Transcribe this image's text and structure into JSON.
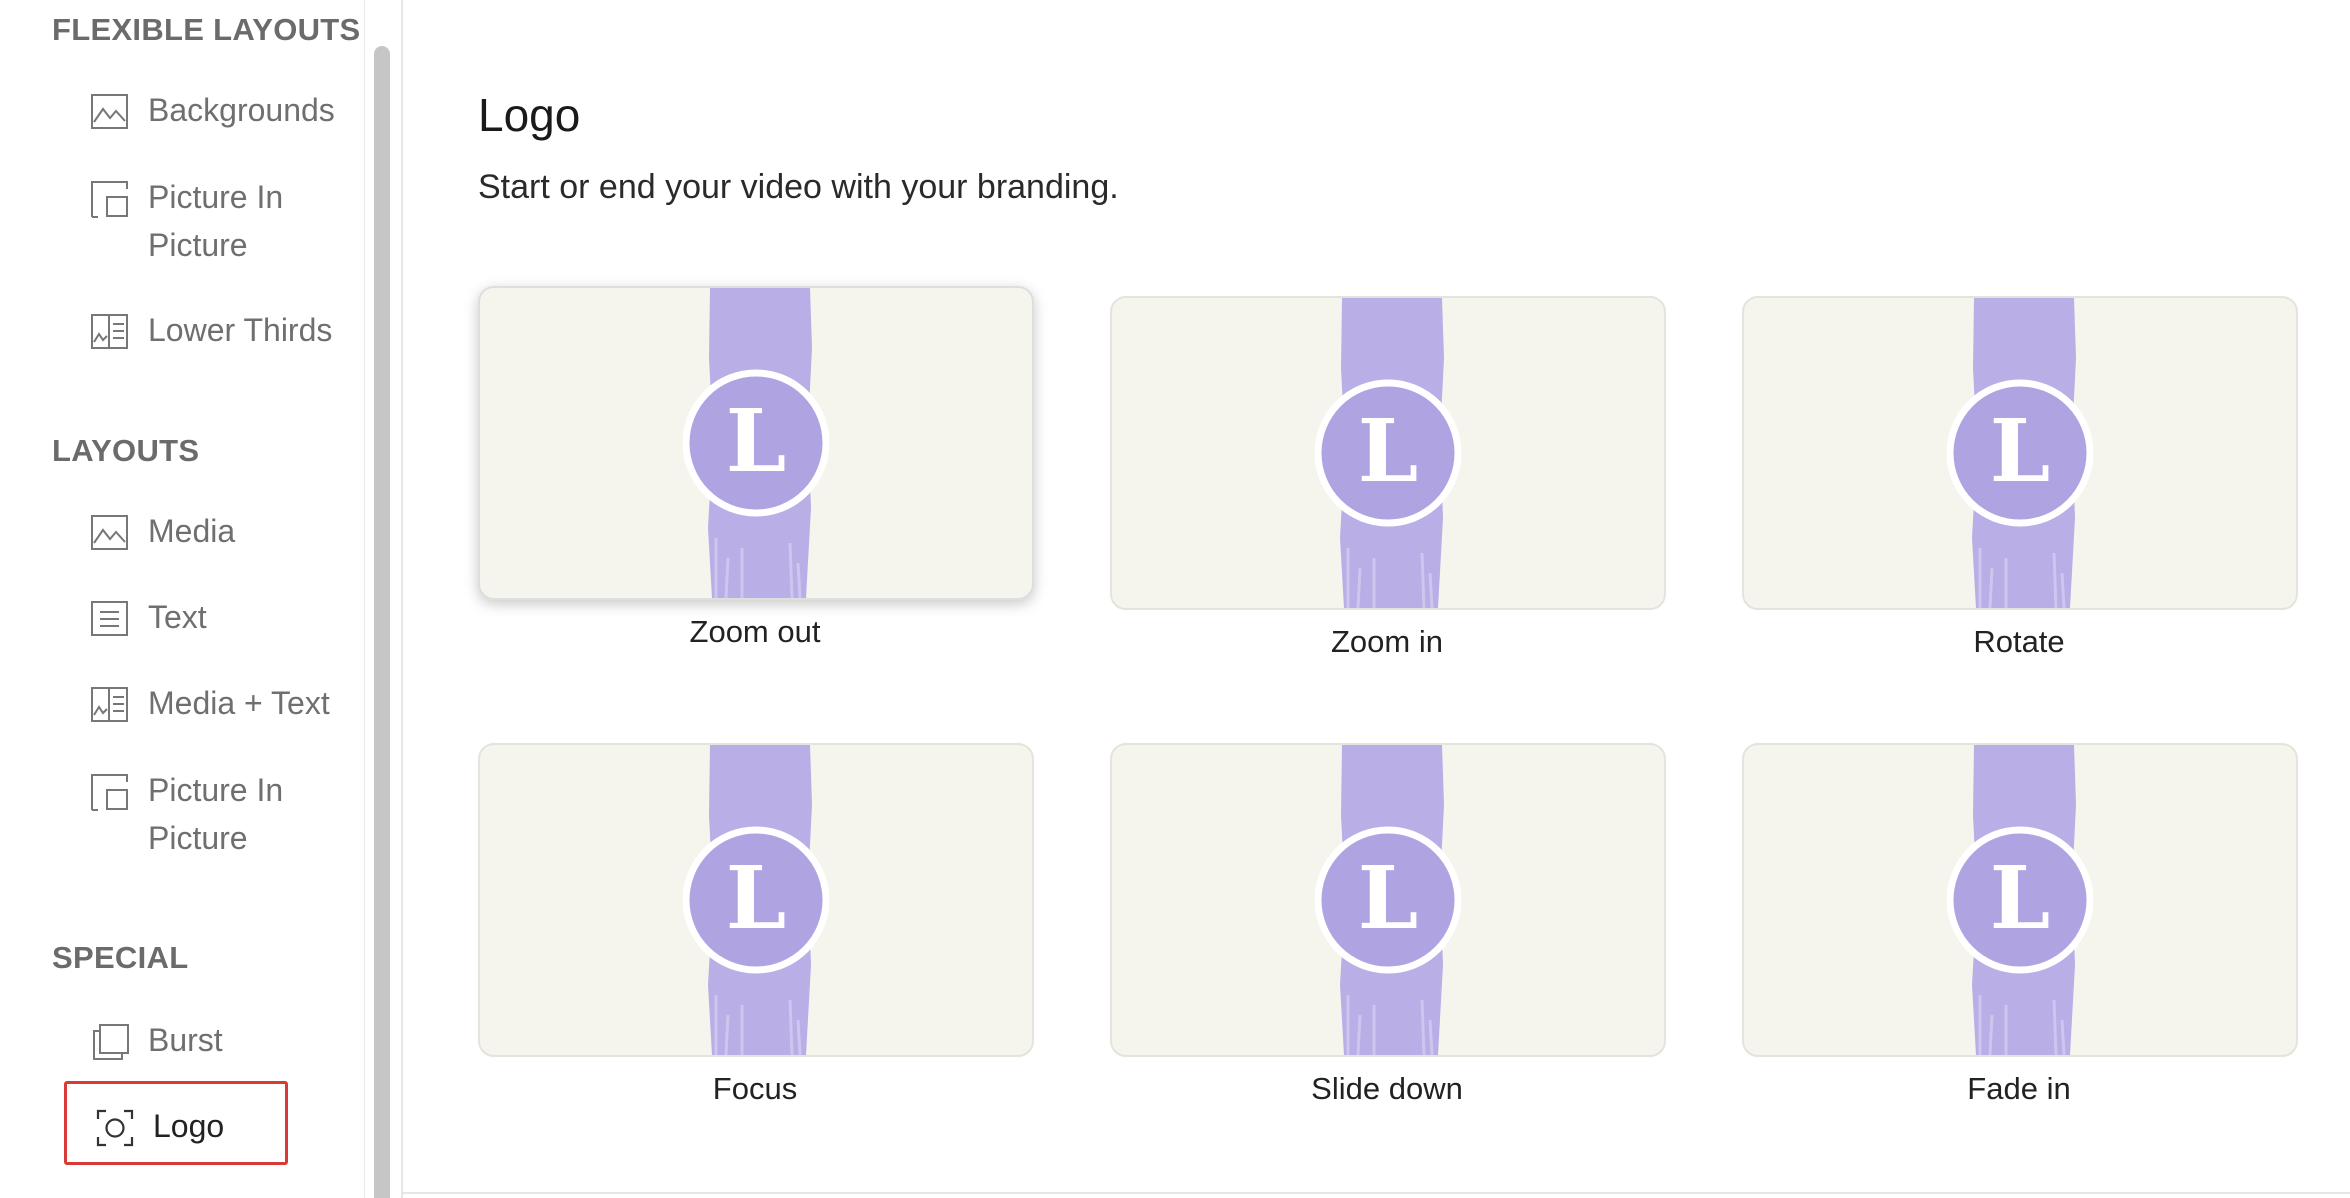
{
  "sidebar": {
    "sections": [
      {
        "title": "FLEXIBLE LAYOUTS",
        "items": [
          {
            "label": "Backgrounds",
            "icon": "image-icon"
          },
          {
            "label": "Picture In Picture",
            "icon": "picture-in-picture-icon"
          },
          {
            "label": "Lower Thirds",
            "icon": "lower-thirds-icon"
          }
        ]
      },
      {
        "title": "LAYOUTS",
        "items": [
          {
            "label": "Media",
            "icon": "image-icon"
          },
          {
            "label": "Text",
            "icon": "text-icon"
          },
          {
            "label": "Media + Text",
            "icon": "media-text-icon"
          },
          {
            "label": "Picture In Picture",
            "icon": "picture-in-picture-icon"
          }
        ]
      },
      {
        "title": "SPECIAL",
        "items": [
          {
            "label": "Burst",
            "icon": "burst-icon"
          },
          {
            "label": "Logo",
            "icon": "logo-focus-icon",
            "active": true
          }
        ]
      }
    ]
  },
  "main": {
    "title": "Logo",
    "subtitle": "Start or end your video with your branding.",
    "logo_letter": "L",
    "options": [
      {
        "label": "Zoom out",
        "selected": true
      },
      {
        "label": "Zoom in"
      },
      {
        "label": "Rotate"
      },
      {
        "label": "Focus"
      },
      {
        "label": "Slide down"
      },
      {
        "label": "Fade in"
      }
    ]
  },
  "colors": {
    "accent_box": "#d83a35",
    "stripe": "#b9aee6",
    "thumb_bg": "#f5f5ed"
  }
}
